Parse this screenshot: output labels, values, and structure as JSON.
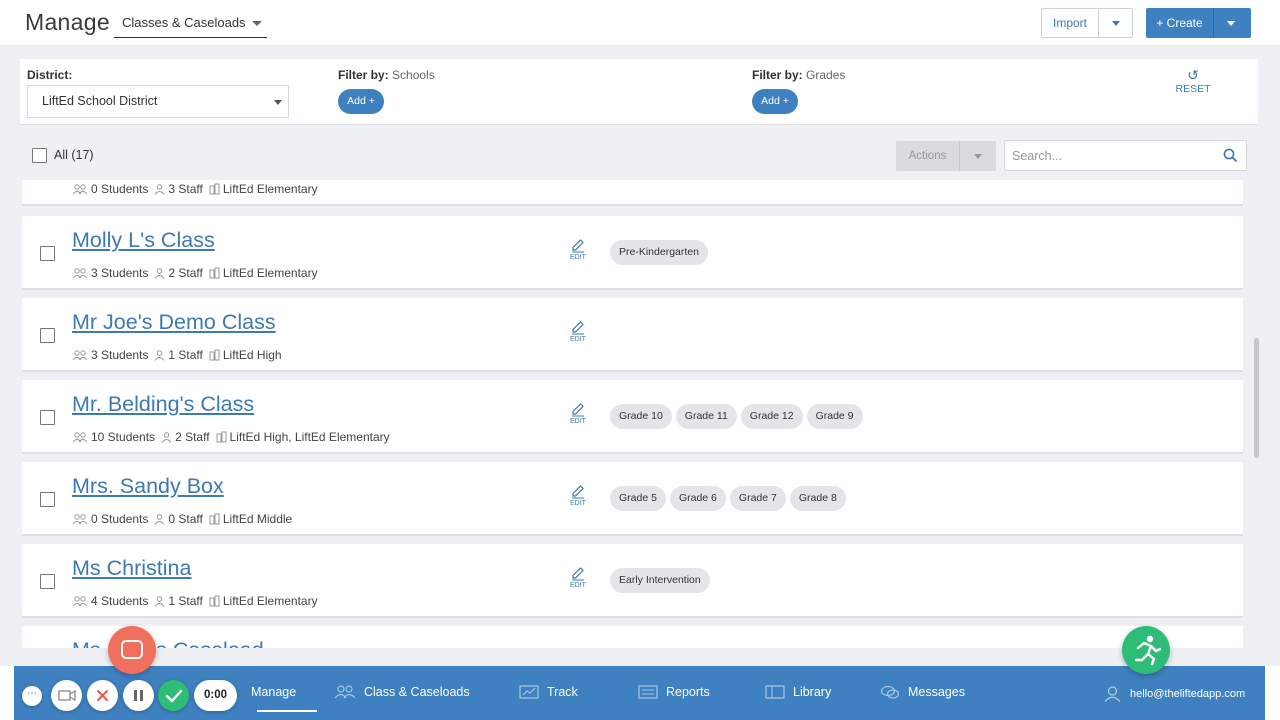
{
  "header": {
    "title": "Manage",
    "view_selector": "Classes & Caseloads",
    "import_label": "Import",
    "create_label": "+ Create"
  },
  "filters": {
    "district_label": "District:",
    "district_value": "LiftEd School District",
    "schools_label": "Filter by:",
    "schools_sub": "Schools",
    "grades_label": "Filter by:",
    "grades_sub": "Grades",
    "add_label": "Add +",
    "reset_label": "RESET"
  },
  "toolbar": {
    "all_label": "All (17)",
    "actions_label": "Actions",
    "search_placeholder": "Search..."
  },
  "partial_top_row": {
    "students": "0 Students",
    "staff": "3 Staff",
    "school": "LiftEd Elementary"
  },
  "rows": [
    {
      "title": "Molly L's Class",
      "students": "3 Students",
      "staff": "2 Staff",
      "school": "LiftEd Elementary",
      "edit": "EDIT",
      "tags": [
        "Pre-Kindergarten"
      ]
    },
    {
      "title": "Mr Joe's Demo Class",
      "students": "3 Students",
      "staff": "1 Staff",
      "school": "LiftEd High",
      "edit": "EDIT",
      "tags": []
    },
    {
      "title": "Mr. Belding's Class",
      "students": "10 Students",
      "staff": "2 Staff",
      "school": "LiftEd High, LiftEd Elementary",
      "edit": "EDIT",
      "tags": [
        "Grade 10",
        "Grade 11",
        "Grade 12",
        "Grade 9"
      ]
    },
    {
      "title": "Mrs. Sandy Box",
      "students": "0 Students",
      "staff": "0 Staff",
      "school": "LiftEd Middle",
      "edit": "EDIT",
      "tags": [
        "Grade 5",
        "Grade 6",
        "Grade 7",
        "Grade 8"
      ]
    },
    {
      "title": "Ms Christina",
      "students": "4 Students",
      "staff": "1 Staff",
      "school": "LiftEd Elementary",
      "edit": "EDIT",
      "tags": [
        "Early Intervention"
      ]
    }
  ],
  "partial_bottom_title": "Ms. ...ck's Caseload",
  "bottom_nav": {
    "manage": "Manage",
    "classes": "Class & Caseloads",
    "track": "Track",
    "reports": "Reports",
    "library": "Library",
    "messages": "Messages",
    "user_email": "hello@theliftedapp.com"
  },
  "recorder": {
    "timer": "0:00"
  },
  "colors": {
    "accent": "#3f81c0",
    "link": "#3d7ab3",
    "chat": "#f06f5d",
    "run": "#2dbd76"
  }
}
